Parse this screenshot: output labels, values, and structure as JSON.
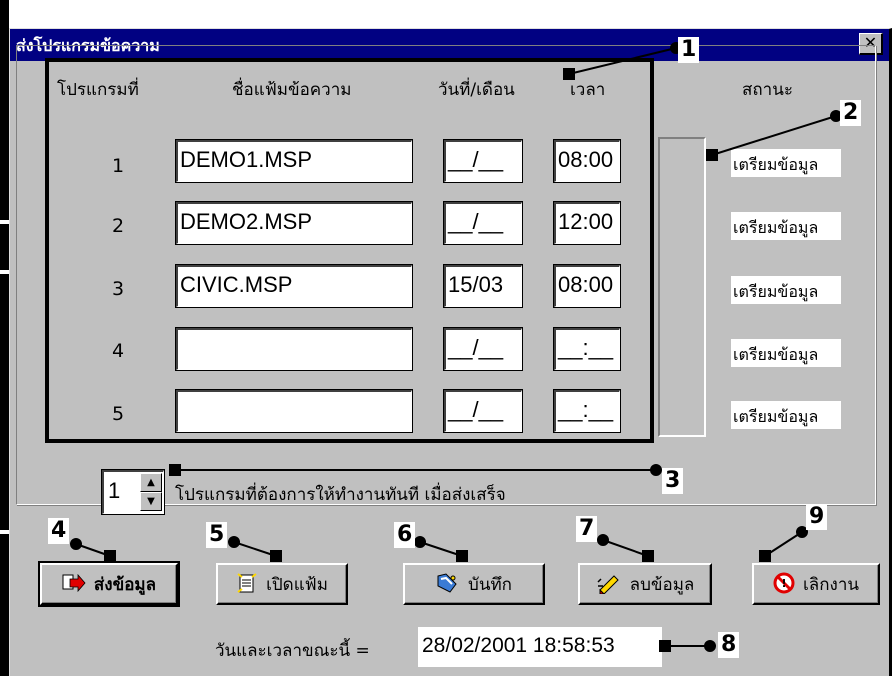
{
  "window": {
    "title": "ส่งโปรแกรมข้อความ",
    "close_glyph": "✕"
  },
  "table": {
    "headers": {
      "program_no": "โปรแกรมที่",
      "file_name": "ชื่อแฟ้มข้อความ",
      "date": "วันที่/เดือน",
      "time": "เวลา",
      "status": "สถานะ"
    },
    "rows": [
      {
        "no": "1",
        "file": "DEMO1.MSP",
        "date": "__/__",
        "time": "08:00",
        "status": "เตรียมข้อมูล"
      },
      {
        "no": "2",
        "file": "DEMO2.MSP",
        "date": "__/__",
        "time": "12:00",
        "status": "เตรียมข้อมูล"
      },
      {
        "no": "3",
        "file": "CIVIC.MSP",
        "date": "15/03",
        "time": "08:00",
        "status": "เตรียมข้อมูล"
      },
      {
        "no": "4",
        "file": "",
        "date": "__/__",
        "time": "__:__",
        "status": "เตรียมข้อมูล"
      },
      {
        "no": "5",
        "file": "",
        "date": "__/__",
        "time": "__:__",
        "status": "เตรียมข้อมูล"
      }
    ]
  },
  "progress": {
    "level": 0
  },
  "run_now": {
    "value": "1",
    "label": "โปรแกรมที่ต้องการให้ทำงานทันที เมื่อส่งเสร็จ"
  },
  "buttons": {
    "send": "ส่งข้อมูล",
    "open": "เปิดแฟ้ม",
    "save": "บันทึก",
    "delete": "ลบข้อมูล",
    "quit": "เลิกงาน"
  },
  "datetime": {
    "label": "วันและเวลาขณะนี้ =",
    "value": "28/02/2001  18:58:53"
  },
  "callouts": [
    "1",
    "2",
    "3",
    "4",
    "5",
    "6",
    "7",
    "8",
    "9"
  ],
  "icons": {
    "send": "send-arrow-icon",
    "open": "open-file-icon",
    "save": "save-icon",
    "delete": "eraser-icon",
    "quit": "stop-icon"
  }
}
